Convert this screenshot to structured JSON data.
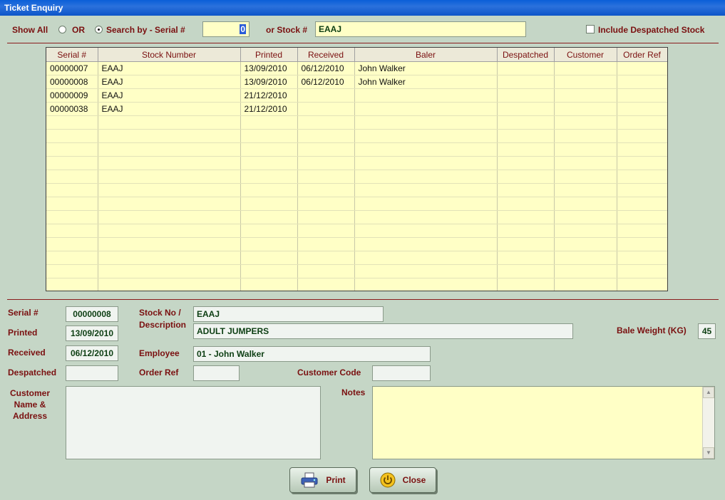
{
  "window": {
    "title": "Ticket Enquiry"
  },
  "search": {
    "show_all_label": "Show All",
    "or_label": "OR",
    "search_by_label": "Search by -  Serial #",
    "serial_value": "0",
    "or_stock_label": "or Stock #",
    "stock_value": "EAAJ",
    "include_despatched_label": "Include Despatched Stock",
    "include_despatched_checked": false,
    "selected_mode": "search_by"
  },
  "grid": {
    "columns": [
      "Serial #",
      "Stock Number",
      "Printed",
      "Received",
      "Baler",
      "Despatched",
      "Customer",
      "Order Ref"
    ],
    "rows": [
      [
        "00000007",
        "EAAJ",
        "13/09/2010",
        "06/12/2010",
        "John Walker",
        "",
        "",
        ""
      ],
      [
        "00000008",
        "EAAJ",
        "13/09/2010",
        "06/12/2010",
        "John Walker",
        "",
        "",
        ""
      ],
      [
        "00000009",
        "EAAJ",
        "21/12/2010",
        "",
        "",
        "",
        "",
        ""
      ],
      [
        "00000038",
        "EAAJ",
        "21/12/2010",
        "",
        "",
        "",
        "",
        ""
      ]
    ],
    "empty_rows": 13
  },
  "details": {
    "serial_label": "Serial #",
    "serial_value": "00000008",
    "printed_label": "Printed",
    "printed_value": "13/09/2010",
    "received_label": "Received",
    "received_value": "06/12/2010",
    "despatched_label": "Despatched",
    "despatched_value": "",
    "stock_label_1": "Stock No /",
    "stock_label_2": "Description",
    "stock_value": "EAAJ",
    "description_value": "ADULT JUMPERS",
    "employee_label": "Employee",
    "employee_value": "01 - John Walker",
    "order_ref_label": "Order Ref",
    "order_ref_value": "",
    "customer_code_label": "Customer Code",
    "customer_code_value": "",
    "bale_weight_label": "Bale Weight (KG)",
    "bale_weight_value": "45",
    "cust_name_label_1": "Customer",
    "cust_name_label_2": "Name &",
    "cust_name_label_3": "Address",
    "customer_address_value": "",
    "notes_label": "Notes",
    "notes_value": ""
  },
  "buttons": {
    "print_label": "Print",
    "close_label": "Close"
  },
  "icons": {
    "print": "printer-icon",
    "close": "power-icon"
  },
  "colors": {
    "background": "#c5d6c6",
    "label": "#7a1010",
    "grid_bg": "#ffffc6",
    "titlebar": "#0a5fd8"
  }
}
